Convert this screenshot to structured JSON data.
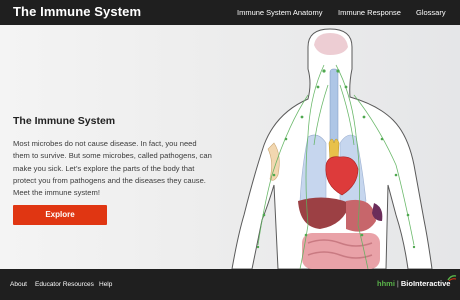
{
  "header": {
    "title": "The Immune System",
    "nav": [
      "Immune System Anatomy",
      "Immune Response",
      "Glossary"
    ]
  },
  "hero": {
    "heading": "The Immune System",
    "description": "Most microbes do not cause disease. In fact, you need them to survive. But some microbes, called pathogens, can make you sick. Let’s explore the parts of the body that protect you from pathogens and the diseases they cause. Meet the immune system!",
    "cta_label": "Explore"
  },
  "footer": {
    "links": [
      "About",
      "Educator Resources",
      "Help"
    ],
    "logo_hhmi": "hhmi",
    "logo_bio": "BioInteractive"
  },
  "colors": {
    "bar": "#1f1f1f",
    "accent": "#e03612",
    "brand_green": "#5ab54a"
  }
}
